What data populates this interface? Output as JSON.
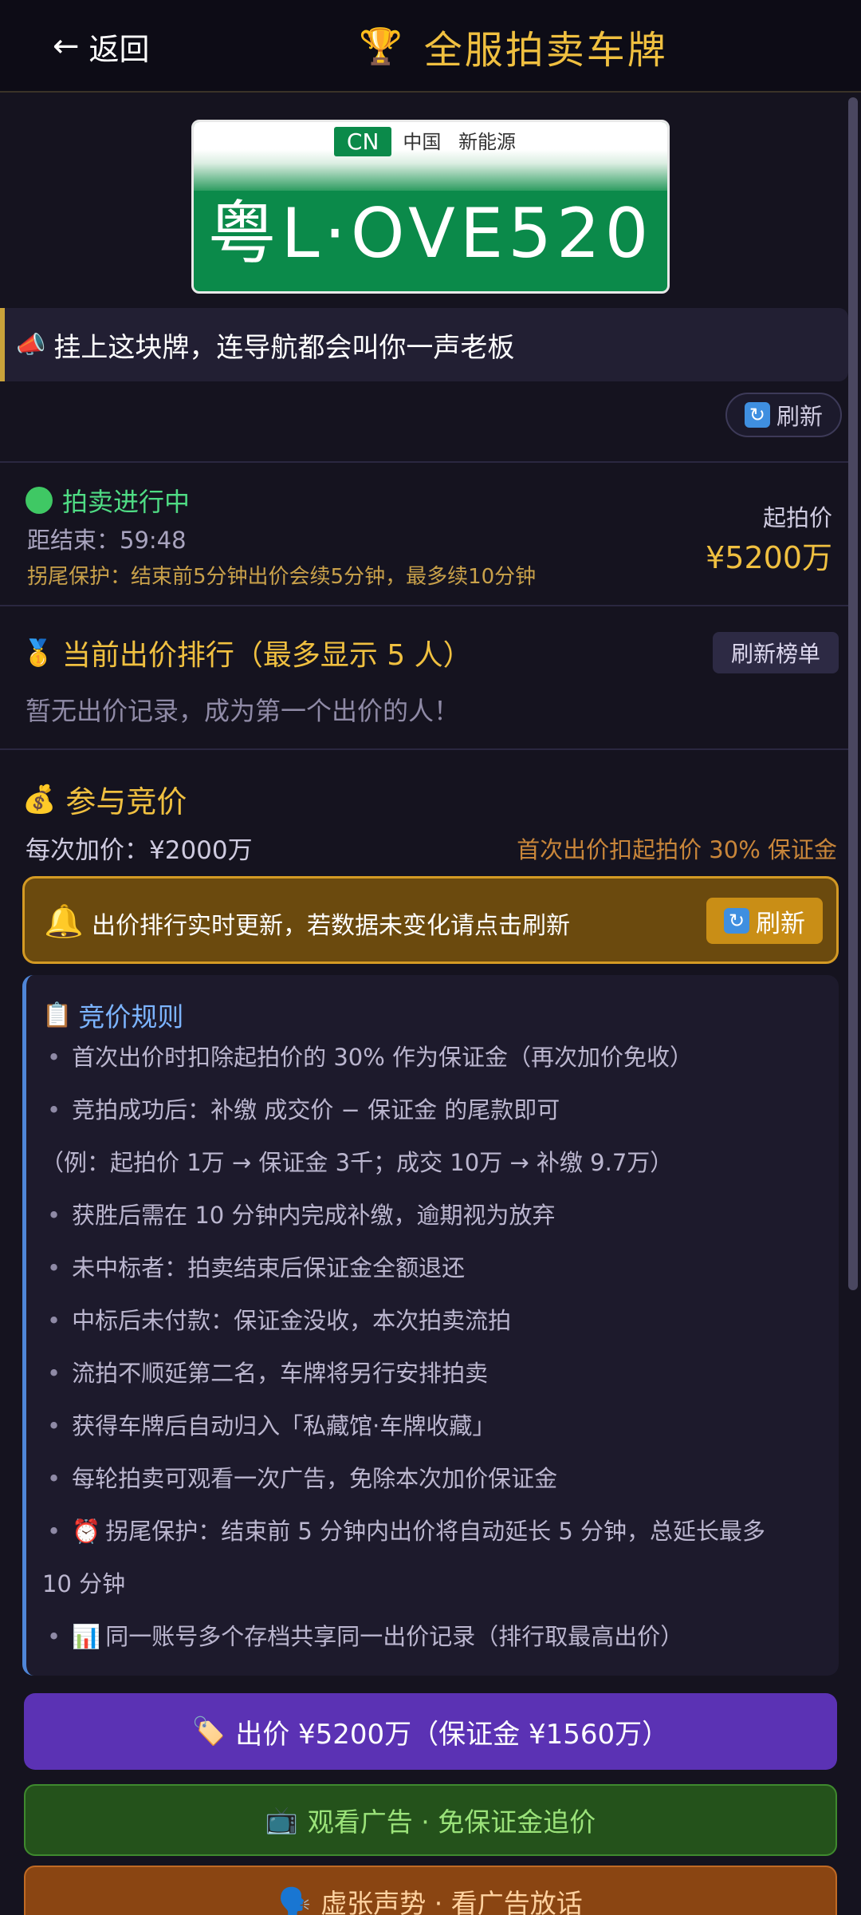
{
  "header": {
    "back_label": "返回",
    "title": "全服拍卖车牌"
  },
  "plate": {
    "country": "CN",
    "region": "中国",
    "type": "新能源",
    "number": "粤L·OVE520"
  },
  "slogan": "挂上这块牌，连导航都会叫你一声老板",
  "refresh_label": "刷新",
  "auction": {
    "status": "拍卖进行中",
    "countdown": "距结束：59:48",
    "protection": "拐尾保护：结束前5分钟出价会续5分钟，最多续10分钟",
    "start_label": "起拍价",
    "start_price": "¥5200万"
  },
  "ranking": {
    "title": "当前出价排行（最多显示 5 人）",
    "refresh_label": "刷新榜单",
    "empty": "暂无出价记录，成为第一个出价的人！"
  },
  "bidding": {
    "title": "参与竞价",
    "increment": "每次加价：¥2000万",
    "deposit_note": "首次出价扣起拍价 30% 保证金"
  },
  "notice": {
    "text": "出价排行实时更新，若数据未变化请点击刷新",
    "button": "刷新"
  },
  "rules": {
    "title": "竞价规则",
    "items": [
      "首次出价时扣除起拍价的 30% 作为保证金（再次加价免收）",
      "竞拍成功后：补缴 成交价 − 保证金 的尾款即可",
      "（例：起拍价 1万 → 保证金 3千；成交 10万 → 补缴 9.7万）",
      "获胜后需在 10 分钟内完成补缴，逾期视为放弃",
      "未中标者：拍卖结束后保证金全额退还",
      "中标后未付款：保证金没收，本次拍卖流拍",
      "流拍不顺延第二名，车牌将另行安排拍卖",
      "获得车牌后自动归入「私藏馆·车牌收藏」",
      "每轮拍卖可观看一次广告，免除本次加价保证金",
      "拐尾保护：结束前 5 分钟内出价将自动延长 5 分钟，总延长最多",
      "10 分钟",
      "同一账号多个存档共享同一出价记录（排行取最高出价）"
    ]
  },
  "actions": {
    "bid": "出价 ¥5200万（保证金 ¥1560万）",
    "watch_ad": "观看广告 · 免保证金追价",
    "bluff": "虚张声势 · 看广告放话"
  },
  "colors": {
    "accent": "#f0c040",
    "plate_green": "#0b8a4a",
    "bid_purple": "#5b32b4"
  }
}
